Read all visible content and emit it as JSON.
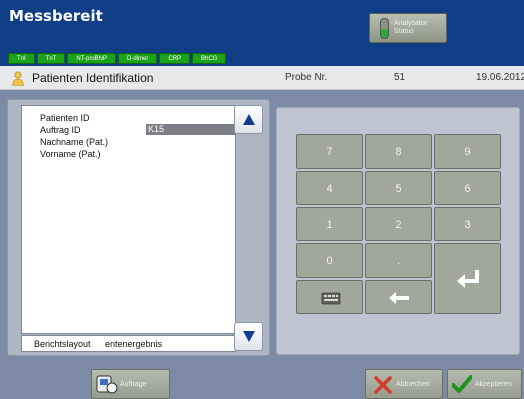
{
  "header": {
    "title": "Messbereit",
    "analyzer_status": "Analysator\nStatus",
    "tests": [
      "TnI",
      "TnT",
      "NT-proBNP",
      "D-dimer",
      "CRP",
      "BhCG"
    ]
  },
  "titlebar": {
    "title": "Patienten Identifikation",
    "probe_label": "Probe Nr.",
    "probe_number": "51",
    "date": "19.06.2012"
  },
  "fields": {
    "patient_id": "Patienten ID",
    "order_id": "Auftrag ID",
    "order_id_value": "K15",
    "last_name": "Nachname (Pat.)",
    "first_name": "Vorname (Pat.)"
  },
  "report": {
    "label": "Berichtslayout",
    "value": "entenergebnis"
  },
  "keypad": {
    "keys": [
      "7",
      "8",
      "9",
      "4",
      "5",
      "6",
      "1",
      "2",
      "3",
      "0",
      "."
    ]
  },
  "footer": {
    "order_button": "Auftrage",
    "cancel_button": "Abbrechen",
    "accept_button": "Akzeptieren"
  },
  "colors": {
    "header_bg": "#0f3d86",
    "test_pill": "#1ca11a",
    "key_bg": "#a2a79c",
    "accept_check": "#1f8f1f",
    "cancel_x": "#d33a2a"
  }
}
